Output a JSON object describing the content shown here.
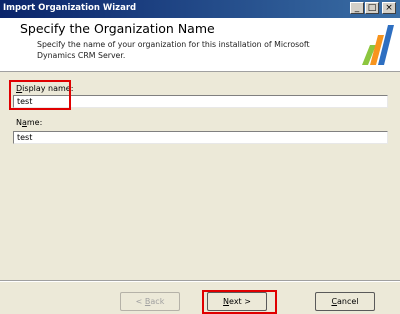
{
  "window": {
    "title": "Import Organization Wizard",
    "minimize_glyph": "_",
    "maximize_glyph": "□",
    "close_glyph": "×"
  },
  "header": {
    "heading": "Specify the Organization Name",
    "description": "Specify the name of your organization for this installation of Microsoft Dynamics CRM Server."
  },
  "fields": {
    "display_name": {
      "label_prefix": "D",
      "label_rest": "isplay name:",
      "value": "test"
    },
    "name": {
      "label_prefix": "N",
      "label_mid": "a",
      "label_rest": "me:",
      "value": "test"
    }
  },
  "buttons": {
    "back": {
      "prefix": "< ",
      "accel": "B",
      "rest": "ack"
    },
    "next": {
      "accel": "N",
      "rest": "ext >"
    },
    "cancel": {
      "accel": "C",
      "rest": "ancel"
    }
  },
  "colors": {
    "title_bar_start": "#0a246a",
    "title_bar_end": "#3a6ea5",
    "dialog_background": "#ece9d8",
    "highlight": "#e00000",
    "logo_green": "#8cc63f",
    "logo_orange": "#f7941d",
    "logo_blue": "#2e6fc1"
  },
  "icons": {
    "logo": "microsoft-dynamics-logo"
  }
}
